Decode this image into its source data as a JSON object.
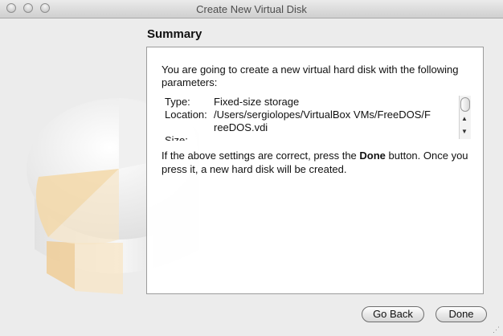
{
  "window": {
    "title": "Create New Virtual Disk"
  },
  "summary": {
    "heading": "Summary",
    "intro": "You are going to create a new virtual hard disk with the following parameters:",
    "params": [
      {
        "label": "Type:",
        "value": "Fixed-size storage"
      },
      {
        "label": "Location:",
        "value": "/Users/sergiolopes/VirtualBox VMs/FreeDOS/F"
      },
      {
        "label": "",
        "value": "reeDOS.vdi"
      },
      {
        "label": "Size:",
        "value": ""
      }
    ],
    "outro_prefix": "If the above settings are correct, press the ",
    "outro_bold": "Done",
    "outro_suffix": " button. Once you press it, a new hard disk will be created."
  },
  "buttons": {
    "back": "Go Back",
    "done": "Done"
  },
  "icons": {
    "close": "close-traffic-light-icon",
    "minimize": "minimize-traffic-light-icon",
    "zoom": "zoom-traffic-light-icon",
    "scroll_up": "arrow-up-icon",
    "scroll_down": "arrow-down-icon",
    "resize": "resize-grip-icon"
  },
  "colors": {
    "disk_accent": "#f3d8a8",
    "window_bg": "#ececec"
  }
}
